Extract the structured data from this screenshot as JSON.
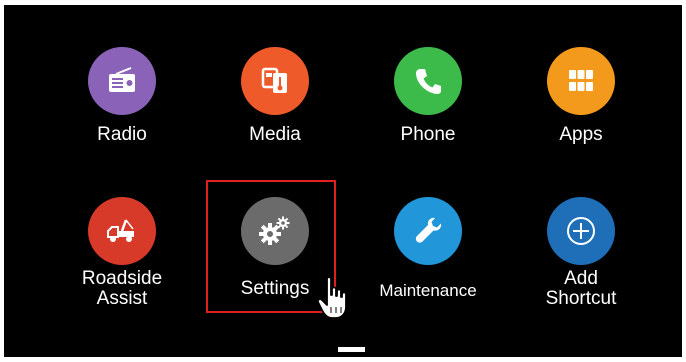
{
  "colors": {
    "radio": "#8a63b8",
    "media": "#ef5a2a",
    "phone": "#3dbb4a",
    "apps": "#f39a1c",
    "roadside": "#d83a2a",
    "settings": "#6b6b6b",
    "maintenance": "#2196d8",
    "shortcut": "#1e6fb8",
    "highlight": "#e02020"
  },
  "tiles": [
    {
      "label": "Radio",
      "icon": "radio-icon"
    },
    {
      "label": "Media",
      "icon": "media-icon"
    },
    {
      "label": "Phone",
      "icon": "phone-icon"
    },
    {
      "label": "Apps",
      "icon": "apps-grid-icon"
    },
    {
      "label": "Roadside\nAssist",
      "icon": "tow-truck-icon"
    },
    {
      "label": "Settings",
      "icon": "gears-icon"
    },
    {
      "label": "Maintenance",
      "icon": "wrench-icon"
    },
    {
      "label": "Add\nShortcut",
      "icon": "plus-circle-icon"
    }
  ]
}
